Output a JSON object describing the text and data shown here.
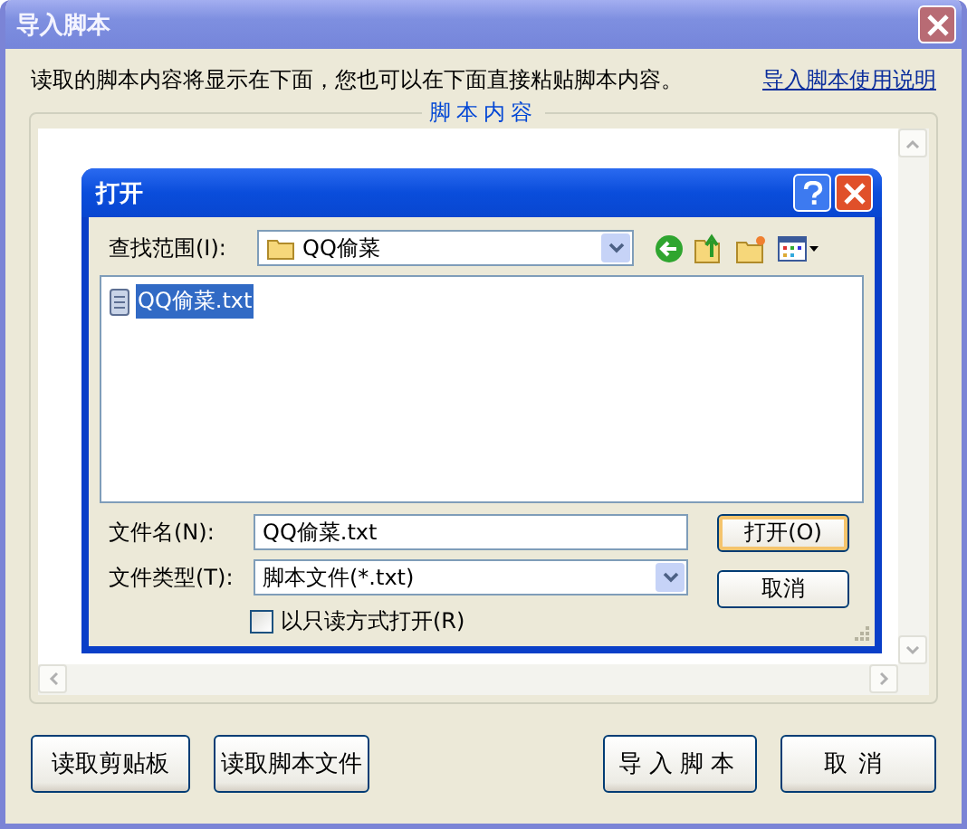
{
  "window": {
    "title": "导入脚本"
  },
  "instruction": "读取的脚本内容将显示在下面，您也可以在下面直接粘贴脚本内容。",
  "help_link": "导入脚本使用说明",
  "group": {
    "title": "脚本内容"
  },
  "open_dialog": {
    "title": "打开",
    "look_in": {
      "label": "查找范围(I):",
      "value": "QQ偷菜"
    },
    "files": [
      {
        "name": "QQ偷菜.txt",
        "selected": true
      }
    ],
    "file_name": {
      "label": "文件名(N):",
      "value": "QQ偷菜.txt"
    },
    "file_type": {
      "label": "文件类型(T):",
      "value": "脚本文件(*.txt)"
    },
    "read_only": {
      "label": "以只读方式打开(R)",
      "checked": false
    },
    "buttons": [
      {
        "label": "打开(O)",
        "default": true
      },
      {
        "label": "取消",
        "default": false
      }
    ]
  },
  "buttons": [
    "读取剪贴板",
    "读取脚本文件",
    "导入脚本",
    "取消"
  ]
}
